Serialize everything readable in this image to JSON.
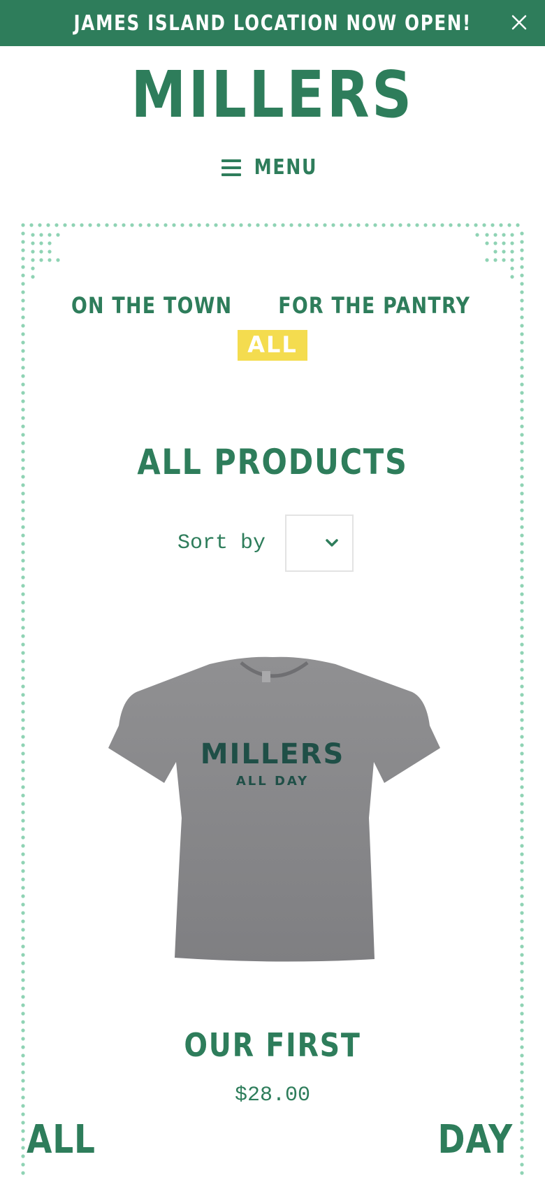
{
  "announcement": {
    "text": "JAMES ISLAND LOCATION NOW OPEN!",
    "close_icon": "close-icon"
  },
  "header": {
    "logo": "MILLERS",
    "menu_label": "MENU",
    "menu_icon": "hamburger-icon"
  },
  "collections": {
    "items": [
      {
        "label": "ON THE TOWN"
      },
      {
        "label": "FOR THE PANTRY"
      }
    ],
    "active": "ALL"
  },
  "page": {
    "title": "ALL PRODUCTS"
  },
  "sort": {
    "label": "Sort by",
    "selected": "",
    "icon": "chevron-down-icon"
  },
  "product": {
    "title": "OUR FIRST",
    "price": "$28.00",
    "image_print_line1": "MILLERS",
    "image_print_line2": "ALL DAY"
  },
  "footer_words": {
    "left": "ALL",
    "right": "DAY"
  },
  "colors": {
    "brand_green": "#2e7d5b",
    "accent_yellow": "#f4dc4f",
    "dot_green": "#8fd3b4",
    "shirt_gray": "#8a8a8c"
  }
}
